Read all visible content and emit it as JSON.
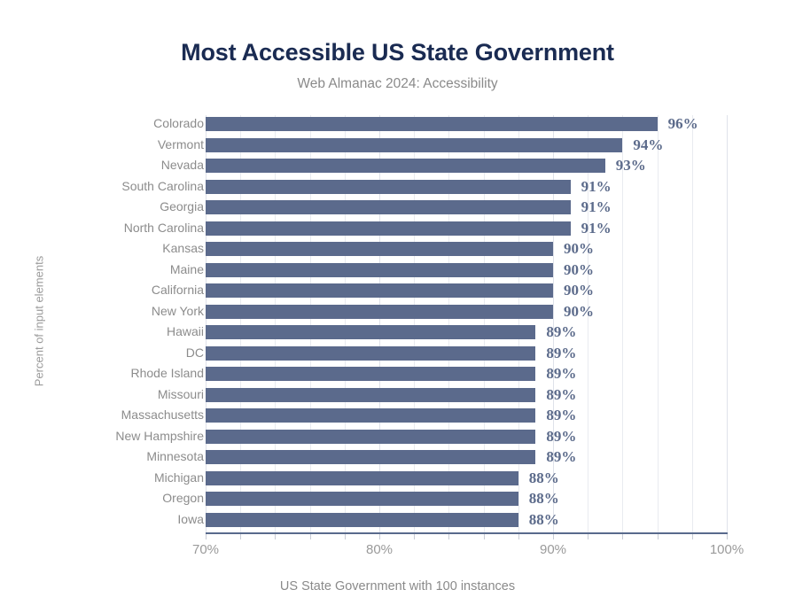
{
  "chart_data": {
    "type": "bar",
    "orientation": "horizontal",
    "title": "Most Accessible US State Government",
    "subtitle": "Web Almanac 2024: Accessibility",
    "xlabel": "US State Government with 100 instances",
    "ylabel": "Percent of input elements",
    "xlim": [
      70,
      100
    ],
    "xticks": [
      70,
      80,
      90,
      100
    ],
    "xtick_labels": [
      "70%",
      "80%",
      "90%",
      "100%"
    ],
    "grid": true,
    "grid_axis": "x",
    "minor_gridline_step": 2,
    "value_suffix": "%",
    "categories": [
      "Colorado",
      "Vermont",
      "Nevada",
      "South Carolina",
      "Georgia",
      "North Carolina",
      "Kansas",
      "Maine",
      "California",
      "New York",
      "Hawaii",
      "DC",
      "Rhode Island",
      "Missouri",
      "Massachusetts",
      "New Hampshire",
      "Minnesota",
      "Michigan",
      "Oregon",
      "Iowa"
    ],
    "values": [
      96,
      94,
      93,
      91,
      91,
      91,
      90,
      90,
      90,
      90,
      89,
      89,
      89,
      89,
      89,
      89,
      89,
      88,
      88,
      88
    ],
    "value_labels": [
      "96%",
      "94%",
      "93%",
      "91%",
      "91%",
      "91%",
      "90%",
      "90%",
      "90%",
      "90%",
      "89%",
      "89%",
      "89%",
      "89%",
      "89%",
      "89%",
      "89%",
      "88%",
      "88%",
      "88%"
    ],
    "colors": {
      "bar": "#5b6a8c",
      "title": "#1a2b52",
      "subtitle": "#8a8a8a",
      "tick_label": "#8c8c8c",
      "value_label": "#5c6b8b",
      "gridline": "#e9ebf0",
      "axis_line": "#586a8c",
      "background": "#ffffff"
    }
  }
}
